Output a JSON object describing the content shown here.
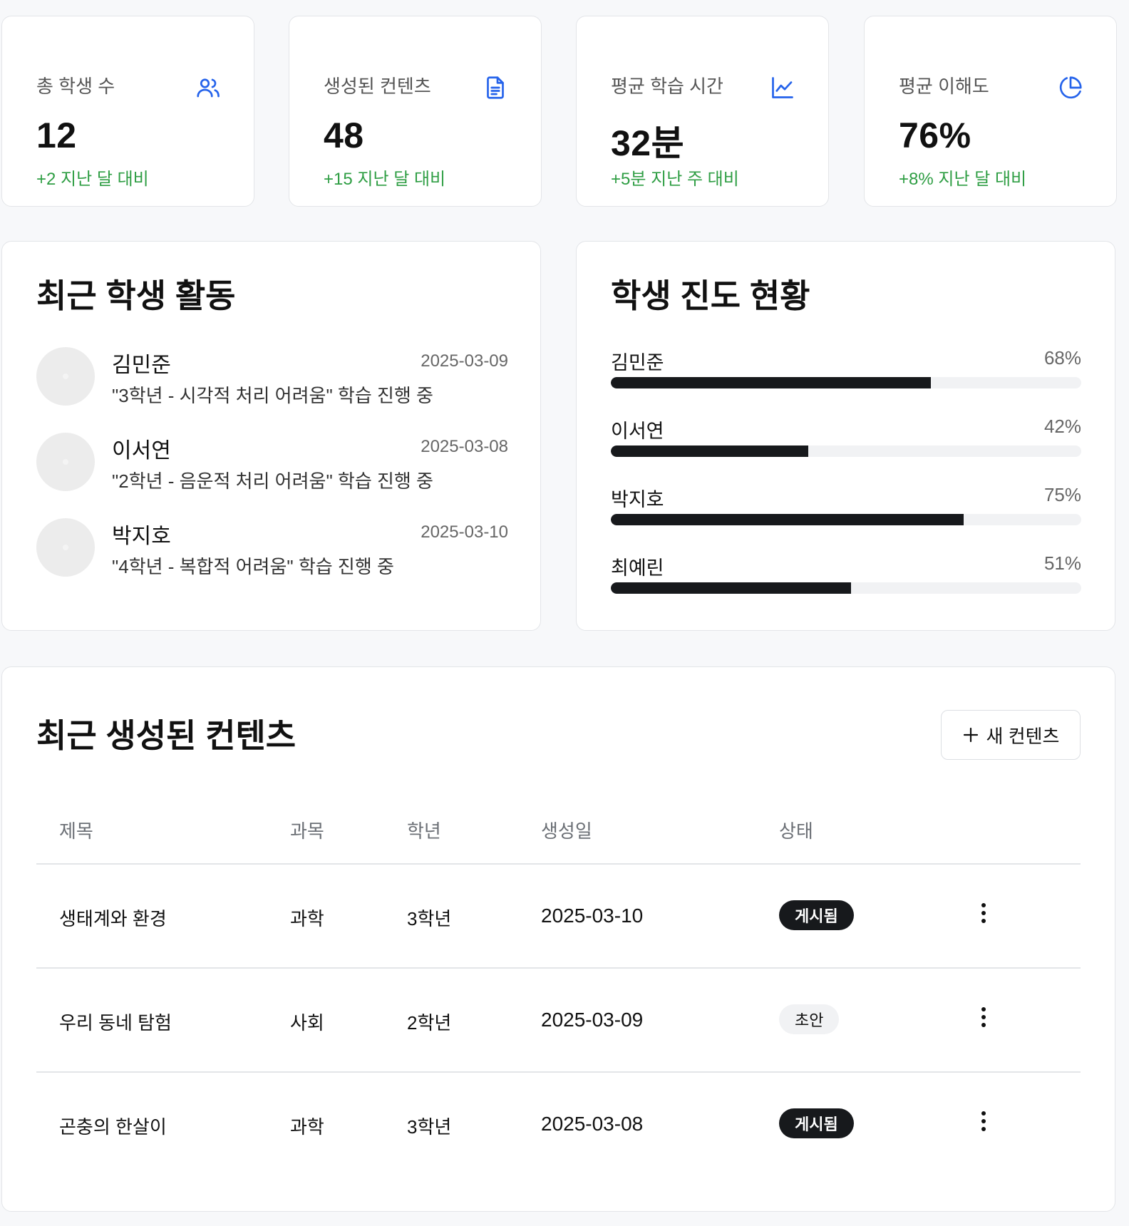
{
  "stats": [
    {
      "label": "총 학생 수",
      "value": "12",
      "delta": "+2 지난 달 대비",
      "icon": "users-icon"
    },
    {
      "label": "생성된 컨텐츠",
      "value": "48",
      "delta": "+15 지난 달 대비",
      "icon": "document-icon"
    },
    {
      "label": "평균 학습 시간",
      "value": "32분",
      "delta": "+5분 지난 주 대비",
      "icon": "line-chart-icon"
    },
    {
      "label": "평균 이해도",
      "value": "76%",
      "delta": "+8% 지난 달 대비",
      "icon": "pie-chart-icon"
    }
  ],
  "activity": {
    "title": "최근 학생 활동",
    "items": [
      {
        "name": "김민준",
        "date": "2025-03-09",
        "desc": "\"3학년 - 시각적 처리 어려움\" 학습 진행 중"
      },
      {
        "name": "이서연",
        "date": "2025-03-08",
        "desc": "\"2학년 - 음운적 처리 어려움\" 학습 진행 중"
      },
      {
        "name": "박지호",
        "date": "2025-03-10",
        "desc": "\"4학년 - 복합적 어려움\" 학습 진행 중"
      }
    ]
  },
  "progress": {
    "title": "학생 진도 현황",
    "items": [
      {
        "name": "김민준",
        "pct_label": "68%",
        "value": 68
      },
      {
        "name": "이서연",
        "pct_label": "42%",
        "value": 42
      },
      {
        "name": "박지호",
        "pct_label": "75%",
        "value": 75
      },
      {
        "name": "최예린",
        "pct_label": "51%",
        "value": 51
      }
    ]
  },
  "content": {
    "title": "최근 생성된 컨텐츠",
    "new_button": "새 컨텐츠",
    "headers": {
      "title": "제목",
      "subject": "과목",
      "grade": "학년",
      "created": "생성일",
      "status": "상태"
    },
    "rows": [
      {
        "title": "생태계와 환경",
        "subject": "과학",
        "grade": "3학년",
        "created": "2025-03-10",
        "status": "게시됨",
        "status_style": "dark"
      },
      {
        "title": "우리 동네 탐험",
        "subject": "사회",
        "grade": "2학년",
        "created": "2025-03-09",
        "status": "초안",
        "status_style": "light"
      },
      {
        "title": "곤충의 한살이",
        "subject": "과학",
        "grade": "3학년",
        "created": "2025-03-08",
        "status": "게시됨",
        "status_style": "dark"
      }
    ]
  },
  "colors": {
    "accent": "#2563eb",
    "positive": "#2f9e44",
    "bar": "#17191c"
  }
}
